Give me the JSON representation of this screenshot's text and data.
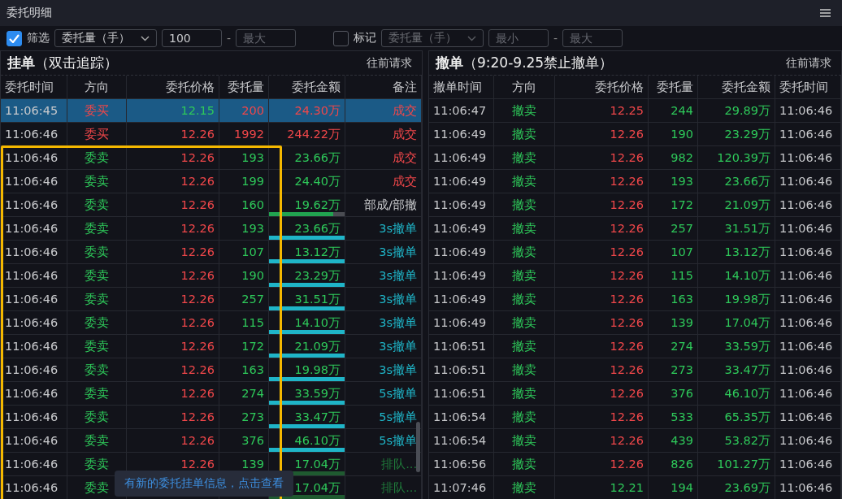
{
  "window": {
    "title": "委托明细"
  },
  "filter": {
    "enabled": {
      "label": "筛选",
      "checked": true
    },
    "field": {
      "value": "委托量（手）",
      "disabled": false
    },
    "min": {
      "value": "100"
    },
    "separator": "-",
    "max": {
      "placeholder": "最大"
    }
  },
  "mark": {
    "enabled": {
      "label": "标记",
      "checked": false
    },
    "field": {
      "value": "委托量（手）",
      "disabled": true
    },
    "min": {
      "placeholder": "最小"
    },
    "separator": "-",
    "max": {
      "placeholder": "最大"
    }
  },
  "pending": {
    "title": "挂单",
    "subtitle": "（双击追踪）",
    "action": "往前请求",
    "columns": [
      "委托时间",
      "方向",
      "委托价格",
      "委托量",
      "委托金额",
      "备注"
    ],
    "rows": [
      {
        "time": "11:06:45",
        "side": "委买",
        "buy": true,
        "price": "12.15",
        "up": false,
        "qty": "200",
        "amount": "24.30万",
        "note": "成交",
        "color": "#f0474a",
        "selected": true
      },
      {
        "time": "11:06:46",
        "side": "委买",
        "buy": true,
        "price": "12.26",
        "up": true,
        "qty": "1992",
        "amount": "244.22万",
        "note": "成交",
        "color": "#f0474a",
        "selected": false
      },
      {
        "time": "11:06:46",
        "side": "委卖",
        "buy": false,
        "price": "12.26",
        "up": true,
        "qty": "193",
        "amount": "23.66万",
        "note": "成交",
        "color": "#f0474a",
        "selected": false
      },
      {
        "time": "11:06:46",
        "side": "委卖",
        "buy": false,
        "price": "12.26",
        "up": true,
        "qty": "199",
        "amount": "24.40万",
        "note": "成交",
        "color": "#f0474a",
        "selected": false
      },
      {
        "time": "11:06:46",
        "side": "委卖",
        "buy": false,
        "price": "12.26",
        "up": true,
        "qty": "160",
        "amount": "19.62万",
        "note": "部成/部撤",
        "color": "#c8c9cc",
        "bar": {
          "level": 0.85,
          "color": "#21a350"
        },
        "selected": false
      },
      {
        "time": "11:06:46",
        "side": "委卖",
        "buy": false,
        "price": "12.26",
        "up": true,
        "qty": "193",
        "amount": "23.66万",
        "note": "3s撤单",
        "color": "#1fb5c8",
        "bar": {
          "level": 1,
          "color": "#1fb5c8"
        },
        "selected": false
      },
      {
        "time": "11:06:46",
        "side": "委卖",
        "buy": false,
        "price": "12.26",
        "up": true,
        "qty": "107",
        "amount": "13.12万",
        "note": "3s撤单",
        "color": "#1fb5c8",
        "bar": {
          "level": 1,
          "color": "#1fb5c8"
        },
        "selected": false
      },
      {
        "time": "11:06:46",
        "side": "委卖",
        "buy": false,
        "price": "12.26",
        "up": true,
        "qty": "190",
        "amount": "23.29万",
        "note": "3s撤单",
        "color": "#1fb5c8",
        "bar": {
          "level": 1,
          "color": "#1fb5c8"
        },
        "selected": false
      },
      {
        "time": "11:06:46",
        "side": "委卖",
        "buy": false,
        "price": "12.26",
        "up": true,
        "qty": "257",
        "amount": "31.51万",
        "note": "3s撤单",
        "color": "#1fb5c8",
        "bar": {
          "level": 1,
          "color": "#1fb5c8"
        },
        "selected": false
      },
      {
        "time": "11:06:46",
        "side": "委卖",
        "buy": false,
        "price": "12.26",
        "up": true,
        "qty": "115",
        "amount": "14.10万",
        "note": "3s撤单",
        "color": "#1fb5c8",
        "bar": {
          "level": 1,
          "color": "#1fb5c8"
        },
        "selected": false
      },
      {
        "time": "11:06:46",
        "side": "委卖",
        "buy": false,
        "price": "12.26",
        "up": true,
        "qty": "172",
        "amount": "21.09万",
        "note": "3s撤单",
        "color": "#1fb5c8",
        "bar": {
          "level": 1,
          "color": "#1fb5c8"
        },
        "selected": false
      },
      {
        "time": "11:06:46",
        "side": "委卖",
        "buy": false,
        "price": "12.26",
        "up": true,
        "qty": "163",
        "amount": "19.98万",
        "note": "3s撤单",
        "color": "#1fb5c8",
        "bar": {
          "level": 1,
          "color": "#1fb5c8"
        },
        "selected": false
      },
      {
        "time": "11:06:46",
        "side": "委卖",
        "buy": false,
        "price": "12.26",
        "up": true,
        "qty": "274",
        "amount": "33.59万",
        "note": "5s撤单",
        "color": "#1fb5c8",
        "bar": {
          "level": 1,
          "color": "#1fb5c8"
        },
        "selected": false
      },
      {
        "time": "11:06:46",
        "side": "委卖",
        "buy": false,
        "price": "12.26",
        "up": true,
        "qty": "273",
        "amount": "33.47万",
        "note": "5s撤单",
        "color": "#1fb5c8",
        "bar": {
          "level": 1,
          "color": "#1fb5c8"
        },
        "selected": false
      },
      {
        "time": "11:06:46",
        "side": "委卖",
        "buy": false,
        "price": "12.26",
        "up": true,
        "qty": "376",
        "amount": "46.10万",
        "note": "5s撤单",
        "color": "#1fb5c8",
        "bar": {
          "level": 1,
          "color": "#1fb5c8"
        },
        "selected": false
      },
      {
        "time": "11:06:46",
        "side": "委卖",
        "buy": false,
        "price": "12.26",
        "up": true,
        "qty": "139",
        "amount": "17.04万",
        "note": "排队...",
        "color": "#1f7a3a",
        "bar": {
          "level": 1,
          "color": "#1f5a30"
        },
        "selected": false
      },
      {
        "time": "11:06:46",
        "side": "委卖",
        "buy": false,
        "amount": "17.04万",
        "note": "排队...",
        "color": "#1f7a3a",
        "bar": {
          "level": 1,
          "color": "#1f5a30"
        },
        "selected": false
      }
    ],
    "toast": "有新的委托挂单信息，点击查看"
  },
  "cancelled": {
    "title": "撤单",
    "subtitle": "（9:20-9.25禁止撤单）",
    "action": "往前请求",
    "columns": [
      "撤单时间",
      "方向",
      "委托价格",
      "委托量",
      "委托金额",
      "委托时间"
    ],
    "rows": [
      {
        "time": "11:06:47",
        "side": "撤卖",
        "price": "12.25",
        "up": true,
        "qty": "244",
        "amount": "29.89万",
        "order_time": "11:06:46"
      },
      {
        "time": "11:06:49",
        "side": "撤卖",
        "price": "12.26",
        "up": true,
        "qty": "190",
        "amount": "23.29万",
        "order_time": "11:06:46"
      },
      {
        "time": "11:06:49",
        "side": "撤卖",
        "price": "12.26",
        "up": true,
        "qty": "982",
        "amount": "120.39万",
        "order_time": "11:06:46"
      },
      {
        "time": "11:06:49",
        "side": "撤卖",
        "price": "12.26",
        "up": true,
        "qty": "193",
        "amount": "23.66万",
        "order_time": "11:06:46"
      },
      {
        "time": "11:06:49",
        "side": "撤卖",
        "price": "12.26",
        "up": true,
        "qty": "172",
        "amount": "21.09万",
        "order_time": "11:06:46"
      },
      {
        "time": "11:06:49",
        "side": "撤卖",
        "price": "12.26",
        "up": true,
        "qty": "257",
        "amount": "31.51万",
        "order_time": "11:06:46"
      },
      {
        "time": "11:06:49",
        "side": "撤卖",
        "price": "12.26",
        "up": true,
        "qty": "107",
        "amount": "13.12万",
        "order_time": "11:06:46"
      },
      {
        "time": "11:06:49",
        "side": "撤卖",
        "price": "12.26",
        "up": true,
        "qty": "115",
        "amount": "14.10万",
        "order_time": "11:06:46"
      },
      {
        "time": "11:06:49",
        "side": "撤卖",
        "price": "12.26",
        "up": true,
        "qty": "163",
        "amount": "19.98万",
        "order_time": "11:06:46"
      },
      {
        "time": "11:06:49",
        "side": "撤卖",
        "price": "12.26",
        "up": true,
        "qty": "139",
        "amount": "17.04万",
        "order_time": "11:06:46"
      },
      {
        "time": "11:06:51",
        "side": "撤卖",
        "price": "12.26",
        "up": true,
        "qty": "274",
        "amount": "33.59万",
        "order_time": "11:06:46"
      },
      {
        "time": "11:06:51",
        "side": "撤卖",
        "price": "12.26",
        "up": true,
        "qty": "273",
        "amount": "33.47万",
        "order_time": "11:06:46"
      },
      {
        "time": "11:06:51",
        "side": "撤卖",
        "price": "12.26",
        "up": true,
        "qty": "376",
        "amount": "46.10万",
        "order_time": "11:06:46"
      },
      {
        "time": "11:06:54",
        "side": "撤卖",
        "price": "12.26",
        "up": true,
        "qty": "533",
        "amount": "65.35万",
        "order_time": "11:06:46"
      },
      {
        "time": "11:06:54",
        "side": "撤卖",
        "price": "12.26",
        "up": true,
        "qty": "439",
        "amount": "53.82万",
        "order_time": "11:06:46"
      },
      {
        "time": "11:06:56",
        "side": "撤卖",
        "price": "12.26",
        "up": true,
        "qty": "826",
        "amount": "101.27万",
        "order_time": "11:06:46"
      },
      {
        "time": "11:07:46",
        "side": "撤卖",
        "price": "12.21",
        "up": false,
        "qty": "194",
        "amount": "23.69万",
        "order_time": "11:06:46"
      }
    ]
  }
}
